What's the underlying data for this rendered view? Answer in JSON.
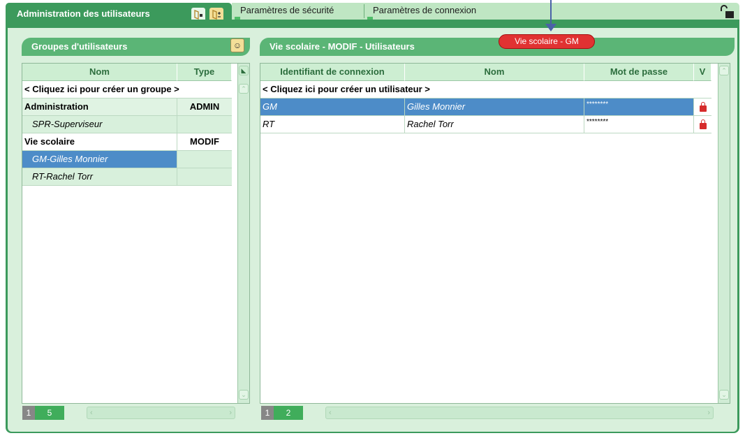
{
  "tabs": {
    "active_label": "Administration des utilisateurs",
    "security_label": "Paramètres de sécurité",
    "connection_label": "Paramètres de connexion"
  },
  "groups_panel": {
    "title": "Groupes d'utilisateurs",
    "columns": [
      "Nom",
      "Type"
    ],
    "create_prompt": "< Cliquez ici pour créer un groupe >",
    "rows": [
      {
        "name": "Administration",
        "type": "ADMIN",
        "kind": "group"
      },
      {
        "name": "SPR-Superviseur",
        "type": "",
        "kind": "member"
      },
      {
        "name": "Vie scolaire",
        "type": "MODIF",
        "kind": "group"
      },
      {
        "name": "GM-Gilles Monnier",
        "type": "",
        "kind": "member",
        "selected": true
      },
      {
        "name": "RT-Rachel Torr",
        "type": "",
        "kind": "member"
      }
    ],
    "pager": {
      "current": "1",
      "total": "5"
    }
  },
  "users_panel": {
    "title": "Vie scolaire - MODIF - Utilisateurs",
    "tooltip": "Vie scolaire - GM",
    "columns": [
      "Identifiant de connexion",
      "Nom",
      "Mot de passe",
      "V"
    ],
    "create_prompt": "< Cliquez ici pour créer un utilisateur >",
    "rows": [
      {
        "login": "GM",
        "name": "Gilles Monnier",
        "password": "********",
        "selected": true
      },
      {
        "login": "RT",
        "name": "Rachel Torr",
        "password": "********",
        "selected": false
      }
    ],
    "pager": {
      "current": "1",
      "total": "2"
    }
  },
  "icons": {
    "tab_icon_1": "user-card-icon",
    "tab_icon_2": "user-group-icon",
    "lock_top": "unlocked-padlock-icon",
    "header_tool": "character-icon",
    "row_lock": "padlock-icon"
  },
  "colors": {
    "primary_green": "#3c9a5c",
    "selection_blue": "#4d8cc8",
    "tooltip_red": "#e13232"
  }
}
